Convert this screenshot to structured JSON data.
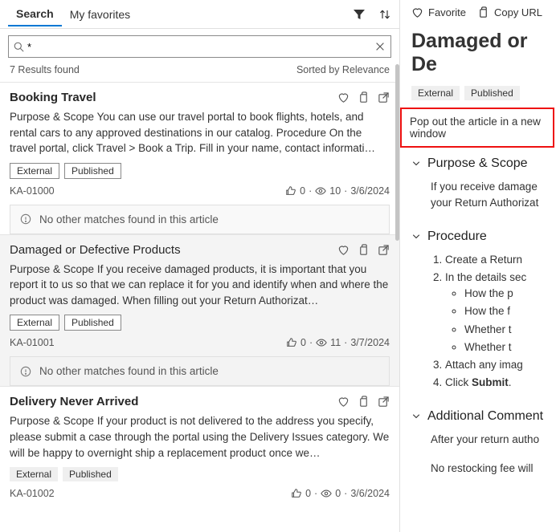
{
  "tabs": {
    "search": "Search",
    "favorites": "My favorites"
  },
  "search": {
    "value": "*",
    "placeholder": ""
  },
  "results_bar": {
    "count": "7 Results found",
    "sort": "Sorted by Relevance"
  },
  "results": [
    {
      "title": "Booking Travel",
      "snippet": "Purpose & Scope You can use our travel portal to book flights, hotels, and rental cars to any approved destinations in our catalog. Procedure On the travel portal, click Travel > Book a Trip. Fill in your name, contact informati…",
      "chips": [
        "External",
        "Published"
      ],
      "id": "KA-01000",
      "likes": "0",
      "views": "10",
      "date": "3/6/2024",
      "nomatch": "No other matches found in this article",
      "chip_style": "bordered"
    },
    {
      "title": "Damaged or Defective Products",
      "snippet": "Purpose & Scope If you receive damaged products, it is important that you report it to us so that we can replace it for you and identify when and where the product was damaged. When filling out your Return Authorizat…",
      "chips": [
        "External",
        "Published"
      ],
      "id": "KA-01001",
      "likes": "0",
      "views": "11",
      "date": "3/7/2024",
      "nomatch": "No other matches found in this article",
      "chip_style": "bordered"
    },
    {
      "title": "Delivery Never Arrived",
      "snippet": "Purpose & Scope If your product is not delivered to the address you specify, please submit a case through the portal using the Delivery Issues category. We will be happy to overnight ship a replacement product once we…",
      "chips": [
        "External",
        "Published"
      ],
      "id": "KA-01002",
      "likes": "0",
      "views": "0",
      "date": "3/6/2024",
      "nomatch": "",
      "chip_style": "plain"
    }
  ],
  "right": {
    "favorite": "Favorite",
    "copy": "Copy URL",
    "title": "Damaged or De",
    "chips": [
      "External",
      "Published"
    ],
    "tooltip": "Pop out the article in a new window",
    "sections": {
      "scope": {
        "head": "Purpose & Scope",
        "body1": "If you receive damage",
        "body2": "your Return Authorizat"
      },
      "procedure": {
        "head": "Procedure",
        "steps": [
          "Create a Return ",
          "In the details sec",
          "Attach any imag",
          "Click "
        ],
        "bullets": [
          "How the p",
          "How the f",
          "Whether t",
          "Whether t"
        ],
        "submit": "Submit"
      },
      "additional": {
        "head": "Additional Comment",
        "body1": "After your return autho",
        "body2": "No restocking fee will "
      }
    }
  }
}
